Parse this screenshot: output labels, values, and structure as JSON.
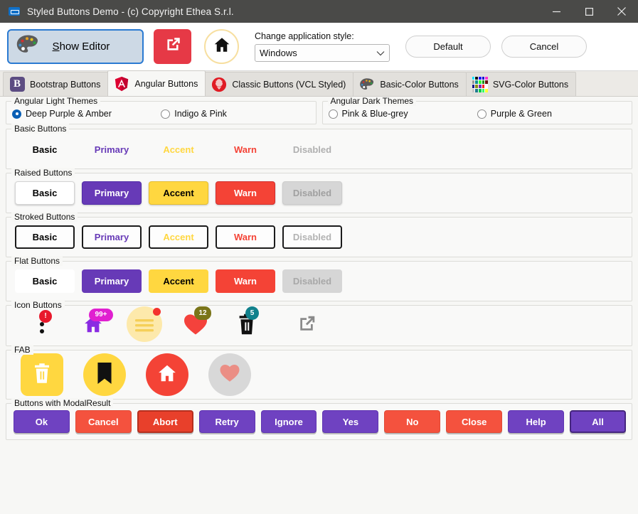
{
  "window": {
    "title": "Styled Buttons Demo - (c) Copyright Ethea S.r.l.",
    "app_icon": "app-window-icon",
    "minimize": "—",
    "maximize": "□",
    "close": "✕"
  },
  "toolbar": {
    "show_editor_prefix": "S",
    "show_editor_rest": "how Editor",
    "show_editor_icon": "palette-icon",
    "external_link_icon": "external-link-icon",
    "home_icon": "home-icon",
    "style_caption": "Change application style:",
    "style_value": "Windows",
    "style_options": [
      "Windows"
    ],
    "default_label": "Default",
    "cancel_label": "Cancel"
  },
  "tabs": [
    {
      "label": "Bootstrap Buttons",
      "icon": "bootstrap-icon",
      "active": false
    },
    {
      "label": "Angular Buttons",
      "icon": "angular-icon",
      "active": true
    },
    {
      "label": "Classic Buttons (VCL Styled)",
      "icon": "delphi-icon",
      "active": false
    },
    {
      "label": "Basic-Color Buttons",
      "icon": "palette-icon",
      "active": false
    },
    {
      "label": "SVG-Color Buttons",
      "icon": "color-grid-icon",
      "active": false
    }
  ],
  "themes": {
    "light": {
      "title": "Angular Light Themes",
      "options": [
        {
          "label": "Deep Purple & Amber",
          "checked": true
        },
        {
          "label": "Indigo & Pink",
          "checked": false
        }
      ]
    },
    "dark": {
      "title": "Angular Dark Themes",
      "options": [
        {
          "label": "Pink & Blue-grey",
          "checked": false
        },
        {
          "label": "Purple & Green",
          "checked": false
        }
      ]
    }
  },
  "sections": {
    "basic": {
      "title": "Basic Buttons",
      "buttons": [
        "Basic",
        "Primary",
        "Accent",
        "Warn",
        "Disabled"
      ]
    },
    "raised": {
      "title": "Raised Buttons",
      "buttons": [
        "Basic",
        "Primary",
        "Accent",
        "Warn",
        "Disabled"
      ]
    },
    "stroked": {
      "title": "Stroked Buttons",
      "buttons": [
        "Basic",
        "Primary",
        "Accent",
        "Warn",
        "Disabled"
      ]
    },
    "flat": {
      "title": "Flat Buttons",
      "buttons": [
        "Basic",
        "Primary",
        "Accent",
        "Warn",
        "Disabled"
      ]
    },
    "icons": {
      "title": "Icon Buttons",
      "items": [
        {
          "icon": "more-vert-icon",
          "badge": "!",
          "badge_color": "#e8192c",
          "badge_text_color": "#ffffff"
        },
        {
          "icon": "home-icon",
          "badge": "99+",
          "badge_color": "#e020d0",
          "badge_text_color": "#ffffff"
        },
        {
          "icon": "menu-icon",
          "badge": "",
          "badge_color": "#f4322c",
          "badge_text_color": "#ffffff"
        },
        {
          "icon": "heart-icon",
          "badge": "12",
          "badge_color": "#7a7519",
          "badge_text_color": "#ffffff"
        },
        {
          "icon": "trash-icon",
          "badge": "5",
          "badge_color": "#11818c",
          "badge_text_color": "#ffffff"
        },
        {
          "icon": "external-link-icon",
          "badge": "",
          "badge_color": "",
          "badge_text_color": ""
        }
      ]
    },
    "fab": {
      "title": "FAB",
      "items": [
        {
          "icon": "trash-icon",
          "shape": "square"
        },
        {
          "icon": "bookmark-icon",
          "shape": "circle-accent"
        },
        {
          "icon": "home-icon",
          "shape": "circle-warn"
        },
        {
          "icon": "heart-icon",
          "shape": "circle-disabled"
        }
      ]
    },
    "modal": {
      "title": "Buttons with ModalResult",
      "buttons": [
        {
          "label": "Ok",
          "style": "purple"
        },
        {
          "label": "Cancel",
          "style": "red"
        },
        {
          "label": "Abort",
          "style": "red-dark-border"
        },
        {
          "label": "Retry",
          "style": "purple"
        },
        {
          "label": "Ignore",
          "style": "purple"
        },
        {
          "label": "Yes",
          "style": "purple"
        },
        {
          "label": "No",
          "style": "red"
        },
        {
          "label": "Close",
          "style": "red"
        },
        {
          "label": "Help",
          "style": "purple"
        },
        {
          "label": "All",
          "style": "purple-dark-border"
        }
      ]
    }
  },
  "colors": {
    "primary": "#673ab7",
    "accent": "#ffd740",
    "warn": "#f44336",
    "disabled": "#d6d6d6",
    "titlebar": "#4a4a48",
    "tab_active": "#f7f7f5",
    "selection_blue": "#0a5fb4"
  }
}
